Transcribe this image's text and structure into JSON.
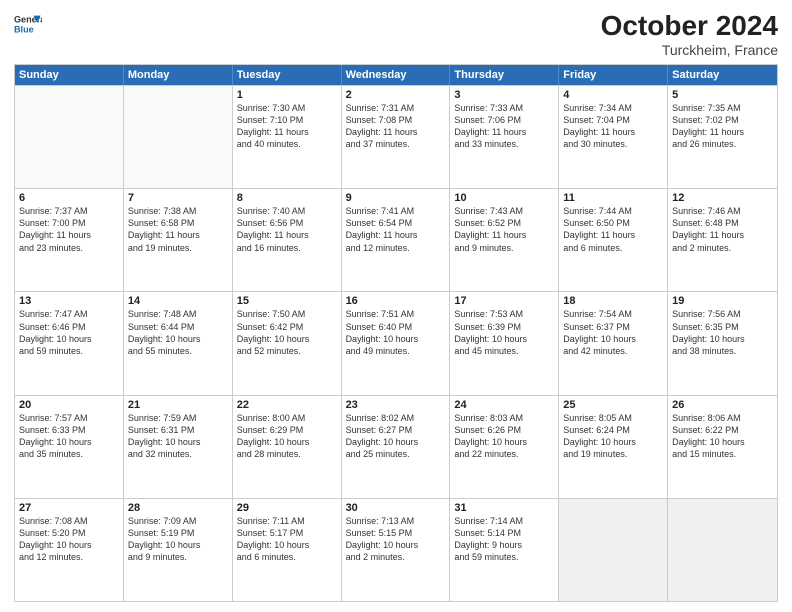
{
  "logo": {
    "line1": "General",
    "line2": "Blue"
  },
  "title": "October 2024",
  "subtitle": "Turckheim, France",
  "days": [
    "Sunday",
    "Monday",
    "Tuesday",
    "Wednesday",
    "Thursday",
    "Friday",
    "Saturday"
  ],
  "weeks": [
    [
      {
        "day": "",
        "lines": [],
        "empty": true
      },
      {
        "day": "",
        "lines": [],
        "empty": true
      },
      {
        "day": "1",
        "lines": [
          "Sunrise: 7:30 AM",
          "Sunset: 7:10 PM",
          "Daylight: 11 hours",
          "and 40 minutes."
        ]
      },
      {
        "day": "2",
        "lines": [
          "Sunrise: 7:31 AM",
          "Sunset: 7:08 PM",
          "Daylight: 11 hours",
          "and 37 minutes."
        ]
      },
      {
        "day": "3",
        "lines": [
          "Sunrise: 7:33 AM",
          "Sunset: 7:06 PM",
          "Daylight: 11 hours",
          "and 33 minutes."
        ]
      },
      {
        "day": "4",
        "lines": [
          "Sunrise: 7:34 AM",
          "Sunset: 7:04 PM",
          "Daylight: 11 hours",
          "and 30 minutes."
        ]
      },
      {
        "day": "5",
        "lines": [
          "Sunrise: 7:35 AM",
          "Sunset: 7:02 PM",
          "Daylight: 11 hours",
          "and 26 minutes."
        ]
      }
    ],
    [
      {
        "day": "6",
        "lines": [
          "Sunrise: 7:37 AM",
          "Sunset: 7:00 PM",
          "Daylight: 11 hours",
          "and 23 minutes."
        ]
      },
      {
        "day": "7",
        "lines": [
          "Sunrise: 7:38 AM",
          "Sunset: 6:58 PM",
          "Daylight: 11 hours",
          "and 19 minutes."
        ]
      },
      {
        "day": "8",
        "lines": [
          "Sunrise: 7:40 AM",
          "Sunset: 6:56 PM",
          "Daylight: 11 hours",
          "and 16 minutes."
        ]
      },
      {
        "day": "9",
        "lines": [
          "Sunrise: 7:41 AM",
          "Sunset: 6:54 PM",
          "Daylight: 11 hours",
          "and 12 minutes."
        ]
      },
      {
        "day": "10",
        "lines": [
          "Sunrise: 7:43 AM",
          "Sunset: 6:52 PM",
          "Daylight: 11 hours",
          "and 9 minutes."
        ]
      },
      {
        "day": "11",
        "lines": [
          "Sunrise: 7:44 AM",
          "Sunset: 6:50 PM",
          "Daylight: 11 hours",
          "and 6 minutes."
        ]
      },
      {
        "day": "12",
        "lines": [
          "Sunrise: 7:46 AM",
          "Sunset: 6:48 PM",
          "Daylight: 11 hours",
          "and 2 minutes."
        ]
      }
    ],
    [
      {
        "day": "13",
        "lines": [
          "Sunrise: 7:47 AM",
          "Sunset: 6:46 PM",
          "Daylight: 10 hours",
          "and 59 minutes."
        ]
      },
      {
        "day": "14",
        "lines": [
          "Sunrise: 7:48 AM",
          "Sunset: 6:44 PM",
          "Daylight: 10 hours",
          "and 55 minutes."
        ]
      },
      {
        "day": "15",
        "lines": [
          "Sunrise: 7:50 AM",
          "Sunset: 6:42 PM",
          "Daylight: 10 hours",
          "and 52 minutes."
        ]
      },
      {
        "day": "16",
        "lines": [
          "Sunrise: 7:51 AM",
          "Sunset: 6:40 PM",
          "Daylight: 10 hours",
          "and 49 minutes."
        ]
      },
      {
        "day": "17",
        "lines": [
          "Sunrise: 7:53 AM",
          "Sunset: 6:39 PM",
          "Daylight: 10 hours",
          "and 45 minutes."
        ]
      },
      {
        "day": "18",
        "lines": [
          "Sunrise: 7:54 AM",
          "Sunset: 6:37 PM",
          "Daylight: 10 hours",
          "and 42 minutes."
        ]
      },
      {
        "day": "19",
        "lines": [
          "Sunrise: 7:56 AM",
          "Sunset: 6:35 PM",
          "Daylight: 10 hours",
          "and 38 minutes."
        ]
      }
    ],
    [
      {
        "day": "20",
        "lines": [
          "Sunrise: 7:57 AM",
          "Sunset: 6:33 PM",
          "Daylight: 10 hours",
          "and 35 minutes."
        ]
      },
      {
        "day": "21",
        "lines": [
          "Sunrise: 7:59 AM",
          "Sunset: 6:31 PM",
          "Daylight: 10 hours",
          "and 32 minutes."
        ]
      },
      {
        "day": "22",
        "lines": [
          "Sunrise: 8:00 AM",
          "Sunset: 6:29 PM",
          "Daylight: 10 hours",
          "and 28 minutes."
        ]
      },
      {
        "day": "23",
        "lines": [
          "Sunrise: 8:02 AM",
          "Sunset: 6:27 PM",
          "Daylight: 10 hours",
          "and 25 minutes."
        ]
      },
      {
        "day": "24",
        "lines": [
          "Sunrise: 8:03 AM",
          "Sunset: 6:26 PM",
          "Daylight: 10 hours",
          "and 22 minutes."
        ]
      },
      {
        "day": "25",
        "lines": [
          "Sunrise: 8:05 AM",
          "Sunset: 6:24 PM",
          "Daylight: 10 hours",
          "and 19 minutes."
        ]
      },
      {
        "day": "26",
        "lines": [
          "Sunrise: 8:06 AM",
          "Sunset: 6:22 PM",
          "Daylight: 10 hours",
          "and 15 minutes."
        ]
      }
    ],
    [
      {
        "day": "27",
        "lines": [
          "Sunrise: 7:08 AM",
          "Sunset: 5:20 PM",
          "Daylight: 10 hours",
          "and 12 minutes."
        ]
      },
      {
        "day": "28",
        "lines": [
          "Sunrise: 7:09 AM",
          "Sunset: 5:19 PM",
          "Daylight: 10 hours",
          "and 9 minutes."
        ]
      },
      {
        "day": "29",
        "lines": [
          "Sunrise: 7:11 AM",
          "Sunset: 5:17 PM",
          "Daylight: 10 hours",
          "and 6 minutes."
        ]
      },
      {
        "day": "30",
        "lines": [
          "Sunrise: 7:13 AM",
          "Sunset: 5:15 PM",
          "Daylight: 10 hours",
          "and 2 minutes."
        ]
      },
      {
        "day": "31",
        "lines": [
          "Sunrise: 7:14 AM",
          "Sunset: 5:14 PM",
          "Daylight: 9 hours",
          "and 59 minutes."
        ]
      },
      {
        "day": "",
        "lines": [],
        "empty": true,
        "shaded": true
      },
      {
        "day": "",
        "lines": [],
        "empty": true,
        "shaded": true
      }
    ]
  ]
}
